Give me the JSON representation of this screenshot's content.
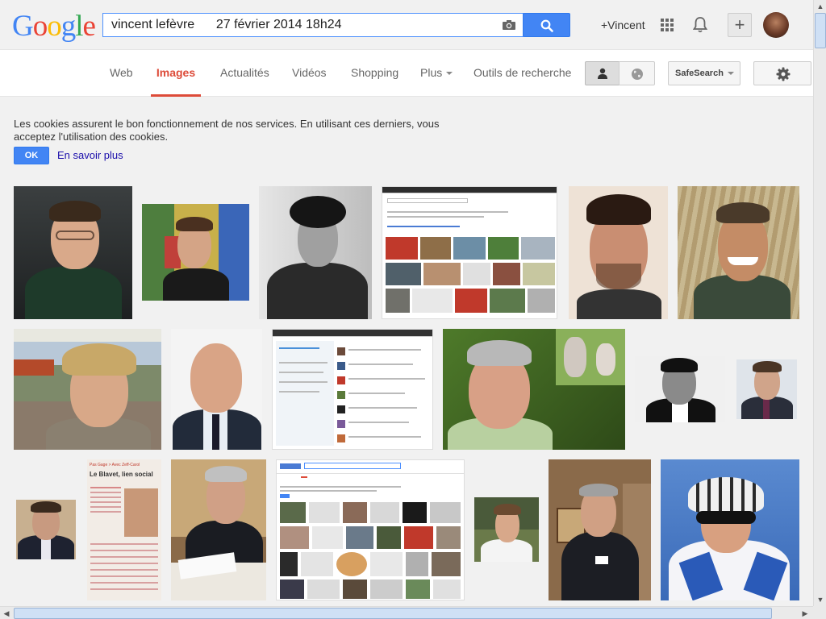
{
  "header": {
    "logo_letters": [
      {
        "char": "G",
        "color": "#4285f4"
      },
      {
        "char": "o",
        "color": "#ea4335"
      },
      {
        "char": "o",
        "color": "#fbbc05"
      },
      {
        "char": "g",
        "color": "#4285f4"
      },
      {
        "char": "l",
        "color": "#34a853"
      },
      {
        "char": "e",
        "color": "#ea4335"
      }
    ],
    "search_value": "vincent lefèvre      27 février 2014 18h24",
    "camera_icon": "camera-icon",
    "search_icon": "magnifier-icon",
    "plus_name": "+Vincent",
    "apps_icon": "apps-grid-icon",
    "notifications_icon": "bell-icon",
    "share_icon": "plus-icon"
  },
  "nav": {
    "tabs": [
      {
        "label": "Web"
      },
      {
        "label": "Images",
        "active": true
      },
      {
        "label": "Actualités"
      },
      {
        "label": "Vidéos"
      },
      {
        "label": "Shopping"
      },
      {
        "label": "Plus"
      },
      {
        "label": "Outils de recherche"
      }
    ],
    "safesearch_label": "SafeSearch",
    "personal_icon": "person-icon",
    "global_icon": "globe-icon",
    "settings_icon": "gear-icon"
  },
  "cookies": {
    "text": "Les cookies assurent le bon fonctionnement de nos services. En utilisant ces derniers, vous acceptez l'utilisation des cookies.",
    "ok_label": "OK",
    "learn_more_label": "En savoir plus"
  },
  "results": {
    "thumb_count": 21
  },
  "screenshot_texts": {
    "blavet_headline": "Le Blavet, lien social",
    "blavet_kicker": "Pas Gage > Avec Zeff-Carol"
  },
  "colors": {
    "accent_red": "#dd4b39",
    "button_blue": "#4285f4",
    "link_blue": "#1a0dab"
  }
}
